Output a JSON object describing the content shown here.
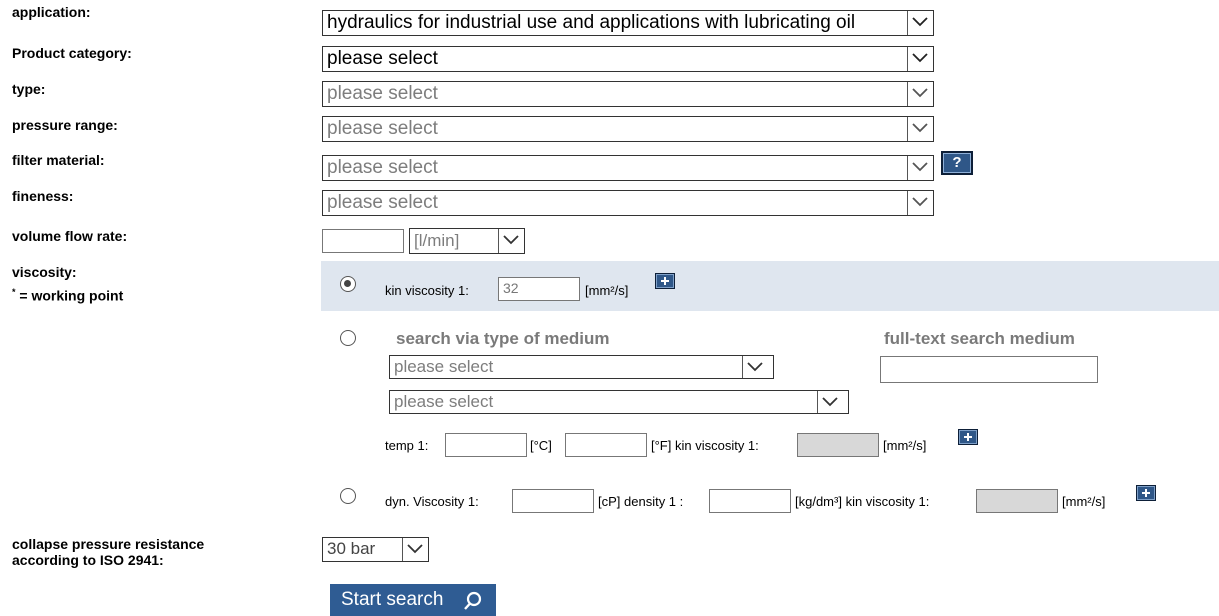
{
  "labels": {
    "application": "application:",
    "product_category": "Product category:",
    "type": "type:",
    "pressure_range": "pressure range:",
    "filter_material": "filter material:",
    "fineness": "fineness:",
    "volume_flow_rate": "volume flow rate:",
    "viscosity": "viscosity:",
    "working_point": "= working point",
    "working_point_star": "*",
    "collapse_line1": "collapse pressure resistance",
    "collapse_line2": "according to ISO 2941:"
  },
  "selects": {
    "application": "hydraulics for industrial use and applications with lubricating oil",
    "product_category": "please select",
    "type": "please select",
    "pressure_range": "please select",
    "filter_material": "please select",
    "fineness": "please select",
    "flow_unit": "[l/min]",
    "medium_type": "please select",
    "medium": "please select",
    "collapse_pressure": "30 bar"
  },
  "viscosity": {
    "kin_label": "kin viscosity 1:",
    "kin_value": "32",
    "kin_unit": "[mm²/s]",
    "search_type_header": "search via type of medium",
    "fulltext_header": "full-text search medium",
    "temp_label": "temp 1:",
    "celsius_unit": "[°C]",
    "fahrenheit_unit": "[°F] kin viscosity 1:",
    "kin_unit2": "[mm²/s]",
    "dyn_label": "dyn. Viscosity 1:",
    "cp_unit": "[cP] density 1 :",
    "density_unit": "[kg/dm³] kin viscosity 1:",
    "kin_unit3": "[mm²/s]"
  },
  "buttons": {
    "help": "?",
    "start_search": "Start search"
  },
  "colors": {
    "highlight_row": "#dfe6ef",
    "button_blue": "#2f5c93",
    "icon_blue": "#2f5788"
  }
}
